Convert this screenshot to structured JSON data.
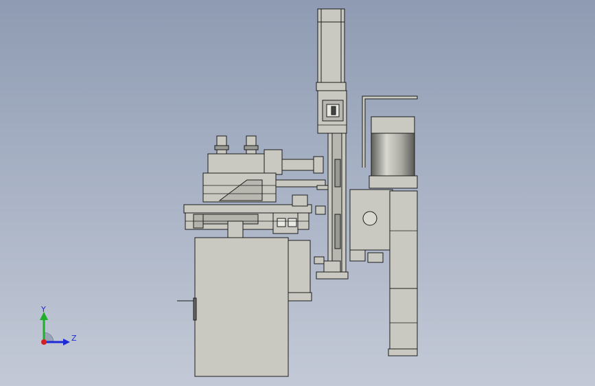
{
  "triad": {
    "y_label": "Y",
    "z_label": "Z"
  },
  "colors": {
    "background_top": "#8e9bb2",
    "background_bottom": "#c3c9d6",
    "part_fill": "#c9c9c2",
    "part_dark": "#8f8f88",
    "edge": "#1a1a1a",
    "axis_y": "#1fae2b",
    "axis_x": "#d42020",
    "axis_z": "#1d2ad6"
  },
  "icons": [
    "coordinate-triad-icon"
  ]
}
